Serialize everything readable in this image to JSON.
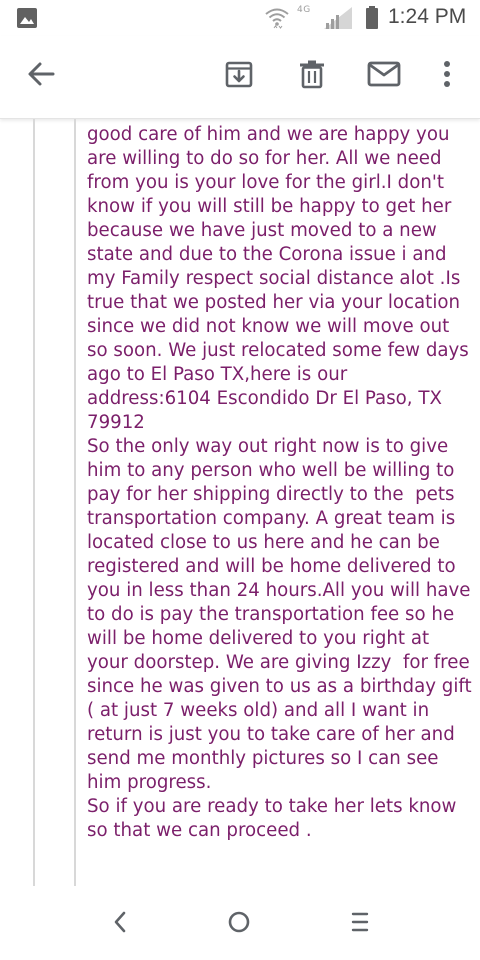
{
  "status_bar": {
    "network_type": "4G",
    "time": "1:24 PM",
    "icons": [
      "photo-icon",
      "wifi-icon",
      "signal-icon",
      "battery-icon"
    ]
  },
  "toolbar": {
    "icons": [
      "arrow-back-icon",
      "archive-icon",
      "delete-icon",
      "mark-unread-icon",
      "more-vert-icon"
    ]
  },
  "message": {
    "text_color": "#7b1f6a",
    "body": "good care of him and we are happy you are willing to do so for her. All we need from you is your love for the girl.I don't know if you will still be happy to get her because we have just moved to a new state and due to the Corona issue i and my Family respect social distance alot .Is true that we posted her via your location since we did not know we will move out so soon. We just relocated some few days ago to El Paso TX,here is our address:6104 Escondido Dr El Paso, TX 79912\nSo the only way out right now is to give him to any person who well be willing to pay for her shipping directly to the  pets transportation company. A great team is located close to us here and he can be registered and will be home delivered to you in less than 24 hours.All you will have to do is pay the transportation fee so he will be home delivered to you right at your doorstep. We are giving Izzy  for free since he was given to us as a birthday gift ( at just 7 weeks old) and all I want in return is just you to take care of her and send me monthly pictures so I can see him progress.\nSo if you are ready to take her lets know so that we can proceed ."
  },
  "nav_bar": {
    "icons": [
      "nav-back-icon",
      "nav-home-icon",
      "nav-recents-icon"
    ]
  }
}
